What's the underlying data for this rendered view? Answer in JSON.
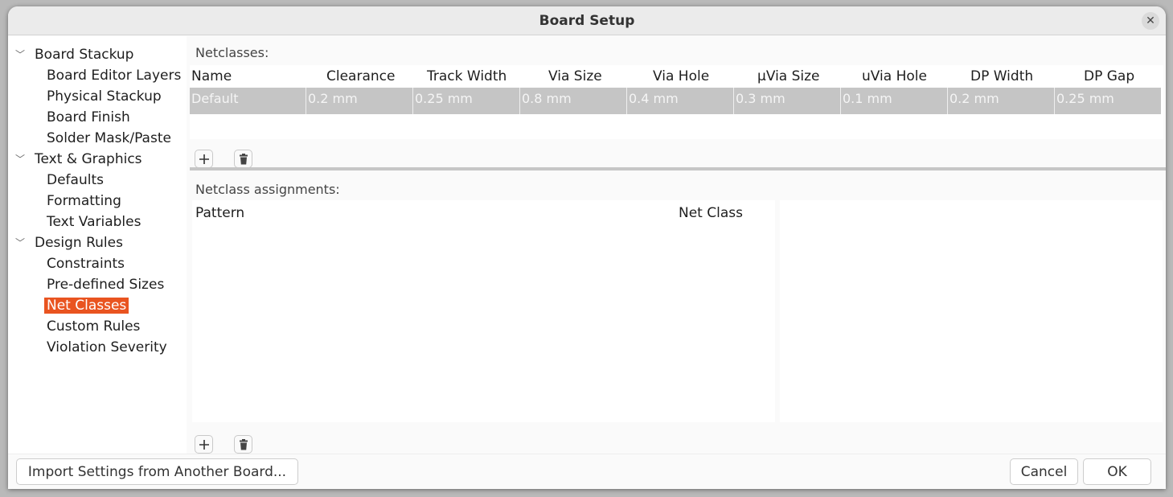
{
  "window": {
    "title": "Board Setup",
    "close_icon": "close-icon"
  },
  "sidebar": {
    "groups": [
      {
        "label": "Board Stackup",
        "children": [
          "Board Editor Layers",
          "Physical Stackup",
          "Board Finish",
          "Solder Mask/Paste"
        ]
      },
      {
        "label": "Text & Graphics",
        "children": [
          "Defaults",
          "Formatting",
          "Text Variables"
        ]
      },
      {
        "label": "Design Rules",
        "children": [
          "Constraints",
          "Pre-defined Sizes",
          "Net Classes",
          "Custom Rules",
          "Violation Severity"
        ]
      }
    ],
    "selected": "Net Classes",
    "selected_color": "#e95420"
  },
  "netclasses": {
    "label": "Netclasses:",
    "columns": [
      "Name",
      "Clearance",
      "Track Width",
      "Via Size",
      "Via Hole",
      "μVia Size",
      "uVia Hole",
      "DP Width",
      "DP Gap"
    ],
    "rows": [
      [
        "Default",
        "0.2 mm",
        "0.25 mm",
        "0.8 mm",
        "0.4 mm",
        "0.3 mm",
        "0.1 mm",
        "0.2 mm",
        "0.25 mm"
      ]
    ],
    "add_icon": "plus-icon",
    "delete_icon": "trash-icon"
  },
  "assignments": {
    "label": "Netclass assignments:",
    "columns": [
      "Pattern",
      "Net Class"
    ],
    "rows": [],
    "add_icon": "plus-icon",
    "delete_icon": "trash-icon"
  },
  "footer": {
    "import_label": "Import Settings from Another Board...",
    "cancel_label": "Cancel",
    "ok_label": "OK"
  }
}
